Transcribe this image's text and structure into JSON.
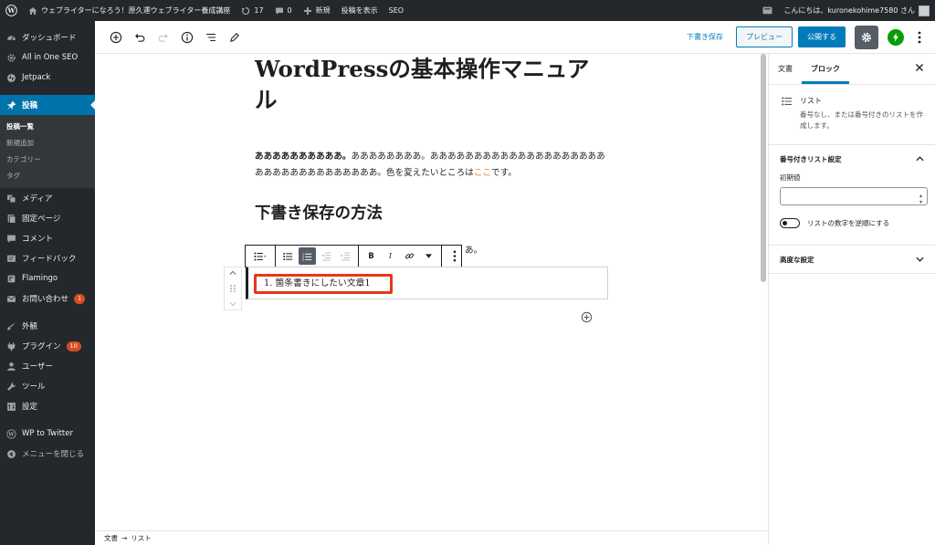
{
  "adminbar": {
    "site_name": "ウェブライターになろう！原久運ウェブライター養成講座",
    "updates_count": "17",
    "comments_count": "0",
    "new_label": "新規",
    "view_post_label": "投稿を表示",
    "seo_label": "SEO",
    "greeting": "こんにちは、kuronekohime7580 さん"
  },
  "sidebar": {
    "items": [
      {
        "label": "ダッシュボード"
      },
      {
        "label": "All in One SEO"
      },
      {
        "label": "Jetpack"
      },
      {
        "label": "投稿"
      },
      {
        "label": "メディア"
      },
      {
        "label": "固定ページ"
      },
      {
        "label": "コメント"
      },
      {
        "label": "フィードバック"
      },
      {
        "label": "Flamingo"
      },
      {
        "label": "お問い合わせ",
        "badge": "1"
      },
      {
        "label": "外観"
      },
      {
        "label": "プラグイン",
        "badge": "10"
      },
      {
        "label": "ユーザー"
      },
      {
        "label": "ツール"
      },
      {
        "label": "設定"
      },
      {
        "label": "WP to Twitter"
      },
      {
        "label": "メニューを閉じる"
      }
    ],
    "submenu": [
      "投稿一覧",
      "新規追加",
      "カテゴリー",
      "タグ"
    ]
  },
  "header": {
    "save_draft": "下書き保存",
    "preview": "プレビュー",
    "publish": "公開する"
  },
  "content": {
    "title": "WordPressの基本操作マニュアル",
    "para_bold": "ああああああああああ。",
    "para_rest": "ああああああああ。ああああああああああああああああああああああああああああああああああ。色を変えたいところは",
    "para_link": "ここ",
    "para_end": "です。",
    "heading": "下書き保存の方法",
    "hidden_tail": "あ。",
    "list_item": "1.  箇条書きにしたい文章1"
  },
  "panel": {
    "tab_document": "文書",
    "tab_block": "ブロック",
    "block_title": "リスト",
    "block_desc": "番号なし、または番号付きのリストを作成します。",
    "numbered_settings": "番号付きリスト設定",
    "start_value_label": "初期値",
    "start_value": "",
    "reverse_label": "リストの数字を逆順にする",
    "advanced": "高度な設定"
  },
  "footer": {
    "crumb_document": "文書",
    "crumb_arrow": "→",
    "crumb_list": "リスト"
  },
  "colors": {
    "accent": "#007cba",
    "admin_bg": "#23282d",
    "highlight_border": "#e8361a",
    "link_orange": "#e97b2b"
  }
}
